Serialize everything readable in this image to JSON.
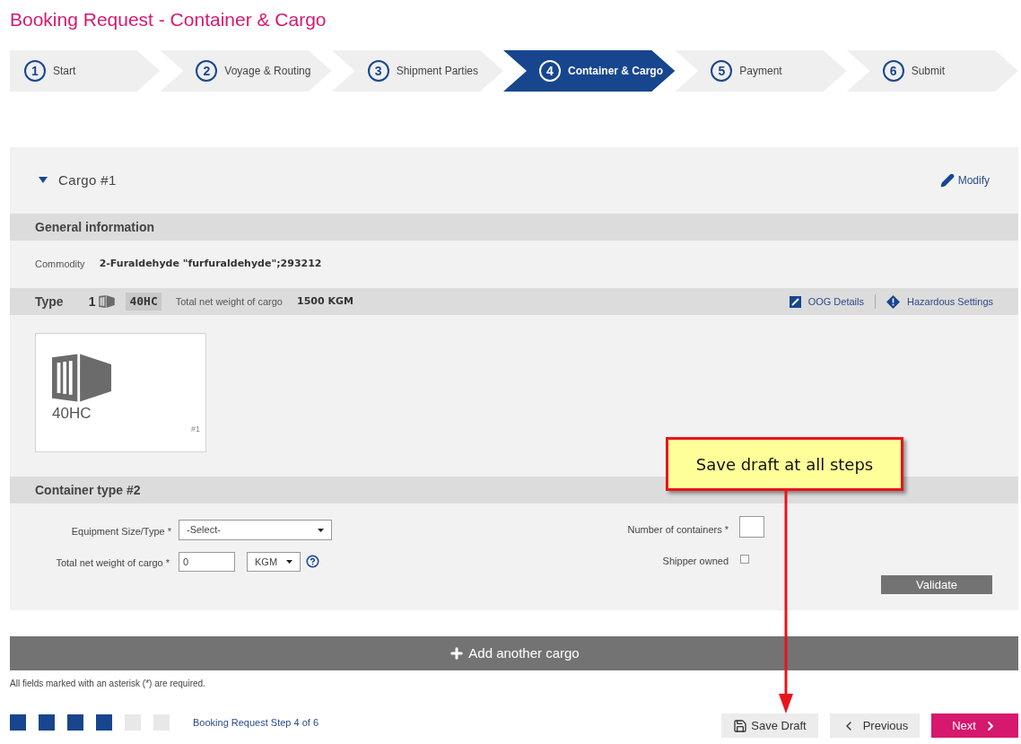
{
  "title": "Booking Request - Container & Cargo",
  "steps": [
    {
      "number": "1",
      "label": "Start",
      "selected": false
    },
    {
      "number": "2",
      "label": "Voyage & Routing",
      "selected": false
    },
    {
      "number": "3",
      "label": "Shipment Parties",
      "selected": false
    },
    {
      "number": "4",
      "label": "Container & Cargo",
      "selected": true
    },
    {
      "number": "5",
      "label": "Payment",
      "selected": false
    },
    {
      "number": "6",
      "label": "Submit",
      "selected": false
    }
  ],
  "cargo": {
    "title": "Cargo #1",
    "expanded": true,
    "modify": "Modify",
    "general_heading": "General information",
    "commodity_label": "Commodity",
    "commodity": "2-Furaldehyde \"furfuraldehyde\";293212",
    "type_label": "Type",
    "type_count": "1",
    "type_code": "40HC",
    "weight_label": "Total net weight of cargo",
    "weight": "1500 KGM",
    "oog": "OOG Details",
    "hazardous": "Hazardous Settings",
    "card": {
      "code": "40HC",
      "index": "#1"
    }
  },
  "container_type": {
    "heading": "Container type #2",
    "equipment_label": "Equipment Size/Type *",
    "equipment_value": "-Select-",
    "weight_label": "Total net weight of cargo *",
    "weight_value": "0",
    "unit": "KGM",
    "count_label": "Number of containers *",
    "shipper_label": "Shipper owned",
    "shipper_owned": false,
    "validate": "Validate"
  },
  "add_cargo": "Add another cargo",
  "required_note": "All fields marked with an asterisk (*) are required.",
  "progress": [
    {
      "done": true
    },
    {
      "done": true
    },
    {
      "done": true
    },
    {
      "done": true
    },
    {
      "done": false
    },
    {
      "done": false
    }
  ],
  "progress_label": "Booking Request Step 4 of 6",
  "buttons": {
    "save": "Save Draft",
    "previous": "Previous",
    "next": "Next"
  },
  "callout": "Save draft at all steps"
}
